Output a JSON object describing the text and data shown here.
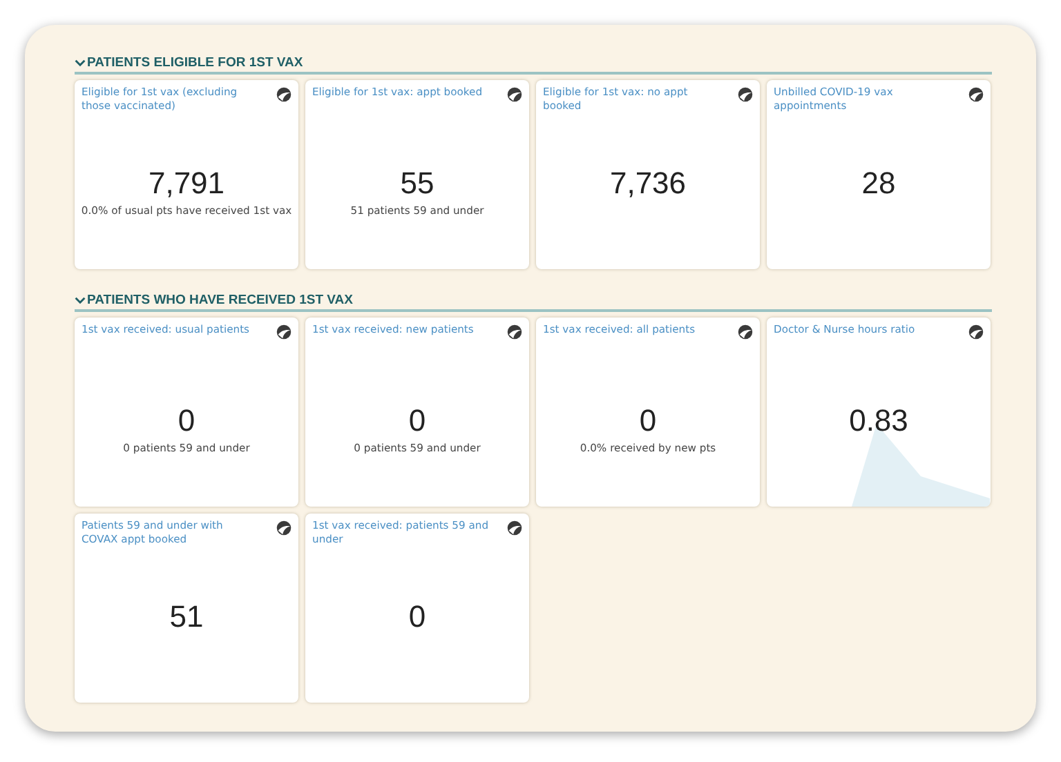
{
  "sections": [
    {
      "title": "PATIENTS ELIGIBLE FOR 1ST VAX",
      "expanded": true,
      "cards": [
        {
          "title": "Eligible for 1st vax (excluding those vaccinated)",
          "value": "7,791",
          "note": "0.0% of usual pts have received 1st vax"
        },
        {
          "title": "Eligible for 1st vax: appt booked",
          "value": "55",
          "note": "51 patients 59 and under"
        },
        {
          "title": "Eligible for 1st vax: no appt booked",
          "value": "7,736"
        },
        {
          "title": "Unbilled COVID-19 vax appointments",
          "value": "28"
        }
      ]
    },
    {
      "title": "PATIENTS WHO HAVE RECEIVED 1ST VAX",
      "expanded": true,
      "cards": [
        {
          "title": "1st vax received: usual patients",
          "value": "0",
          "note": "0 patients 59 and under"
        },
        {
          "title": "1st vax received: new patients",
          "value": "0",
          "note": "0 patients 59 and under"
        },
        {
          "title": "1st vax received: all patients",
          "value": "0",
          "note": "0.0% received by new pts"
        },
        {
          "title": "Doctor & Nurse hours ratio",
          "value": "0.83",
          "kind": "sparkline"
        },
        {
          "title": "Patients 59 and under with COVAX appt booked",
          "value": "51"
        },
        {
          "title": "1st vax received: patients 59 and under",
          "value": "0"
        }
      ]
    }
  ]
}
